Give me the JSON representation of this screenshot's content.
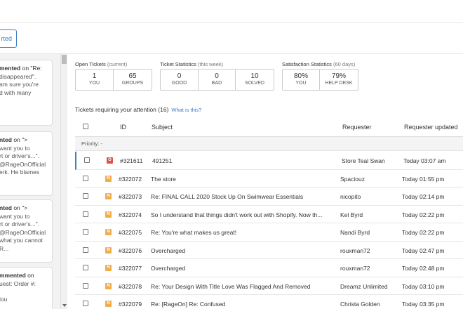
{
  "toolbar": {
    "started_label": "rted"
  },
  "left_panel": {
    "cards": [
      {
        "head_bold": "mented",
        "head_rest": " on \"Re:",
        "lines": [
          "disappeared\".",
          "am sure you're",
          "d with many"
        ]
      },
      {
        "head_bold": "nted",
        "head_rest": " on \">",
        "lines": [
          "want you to",
          "rt or driver's...\".",
          "@RageOnOfficial",
          "erk. He blames"
        ]
      },
      {
        "head_bold": "nted",
        "head_rest": " on \">",
        "lines": [
          "want you to",
          "rt or driver's...\".",
          "@RageOnOfficial",
          "what you cannot",
          "R..."
        ]
      },
      {
        "head_bold": "mmented",
        "head_rest": " on",
        "lines": [
          "uest: Order #:",
          "",
          "lou"
        ]
      }
    ]
  },
  "stats": {
    "open": {
      "title": "Open Tickets",
      "sub": "(current)",
      "items": [
        {
          "num": "1",
          "label": "YOU"
        },
        {
          "num": "65",
          "label": "GROUPS"
        }
      ]
    },
    "week": {
      "title": "Ticket Statistics",
      "sub": "(this week)",
      "items": [
        {
          "num": "0",
          "label": "GOOD"
        },
        {
          "num": "0",
          "label": "BAD"
        },
        {
          "num": "10",
          "label": "SOLVED"
        }
      ]
    },
    "sat": {
      "title": "Satisfaction Statistics",
      "sub": "(60 days)",
      "items": [
        {
          "num": "80%",
          "label": "YOU"
        },
        {
          "num": "79%",
          "label": "HELP DESK"
        }
      ]
    }
  },
  "attention": {
    "title": "Tickets requiring your attention (16)",
    "link": "What is this?"
  },
  "table": {
    "columns": {
      "id": "ID",
      "subject": "Subject",
      "requester": "Requester",
      "updated": "Requester updated"
    },
    "group_label": "Priority: -",
    "rows": [
      {
        "badge": "O",
        "badge_color": "#d9534f",
        "id": "#321611",
        "subject": "491251",
        "requester": "Store Teal Swan",
        "updated": "Today 03:07 am"
      },
      {
        "badge": "N",
        "badge_color": "#f0ad4e",
        "id": "#322072",
        "subject": "The store",
        "requester": "Spaciouz",
        "updated": "Today 01:55 pm"
      },
      {
        "badge": "N",
        "badge_color": "#f0ad4e",
        "id": "#322073",
        "subject": "Re: FINAL CALL 2020 Stock Up On Swimwear Essentials",
        "requester": "nicopito",
        "updated": "Today 02:14 pm"
      },
      {
        "badge": "N",
        "badge_color": "#f0ad4e",
        "id": "#322074",
        "subject": "So I understand that things didn't work out with Shopify. Now th...",
        "requester": "Kel Byrd",
        "updated": "Today 02:22 pm"
      },
      {
        "badge": "N",
        "badge_color": "#f0ad4e",
        "id": "#322075",
        "subject": "Re: You're what makes us great!",
        "requester": "Nandi Byrd",
        "updated": "Today 02:22 pm"
      },
      {
        "badge": "N",
        "badge_color": "#f0ad4e",
        "id": "#322076",
        "subject": "Overcharged",
        "requester": "rouxman72",
        "updated": "Today 02:47 pm"
      },
      {
        "badge": "N",
        "badge_color": "#f0ad4e",
        "id": "#322077",
        "subject": "Overcharged",
        "requester": "rouxman72",
        "updated": "Today 02:48 pm"
      },
      {
        "badge": "N",
        "badge_color": "#f0ad4e",
        "id": "#322078",
        "subject": "Re: Your Design With Title Love Was Flagged And Removed",
        "requester": "Dreamz Unlimited",
        "updated": "Today 03:10 pm"
      },
      {
        "badge": "N",
        "badge_color": "#f0ad4e",
        "id": "#322079",
        "subject": "Re: [RageOn] Re: Confused",
        "requester": "Christa Golden",
        "updated": "Today 03:35 pm"
      }
    ]
  }
}
